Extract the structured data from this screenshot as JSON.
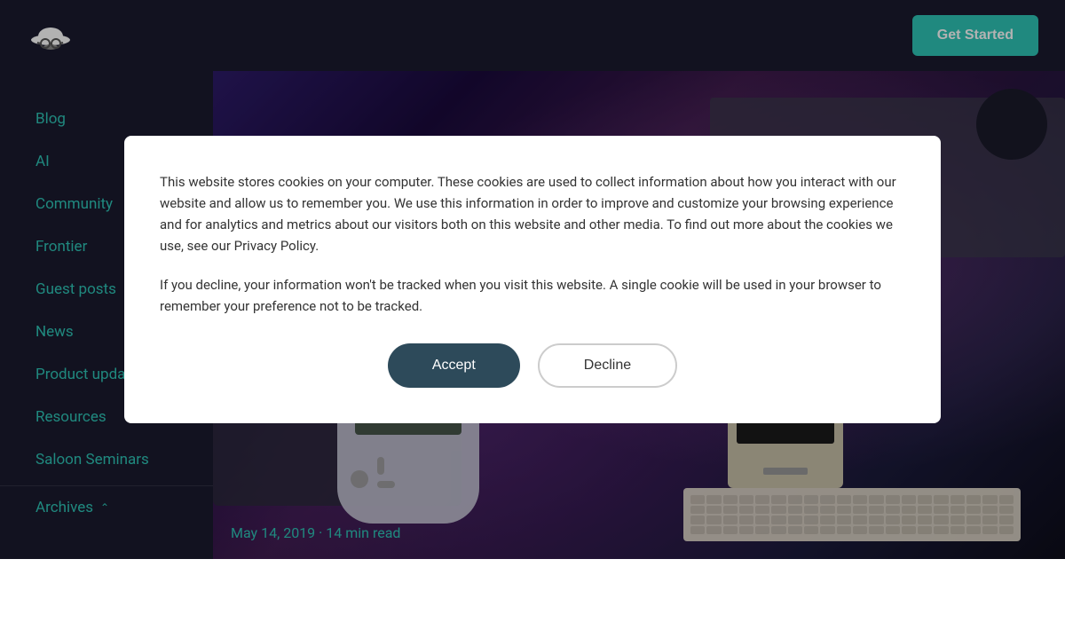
{
  "header": {
    "logo_alt": "Cowboy hat logo",
    "get_started_label": "Get Started"
  },
  "sidebar": {
    "items": [
      {
        "id": "blog",
        "label": "Blog"
      },
      {
        "id": "ai",
        "label": "AI"
      },
      {
        "id": "community",
        "label": "Community"
      },
      {
        "id": "frontier",
        "label": "Frontier"
      },
      {
        "id": "guest-posts",
        "label": "Guest posts"
      },
      {
        "id": "news",
        "label": "News"
      },
      {
        "id": "product-updates",
        "label": "Product updates"
      },
      {
        "id": "resources",
        "label": "Resources"
      },
      {
        "id": "saloon-seminars",
        "label": "Saloon Seminars"
      },
      {
        "id": "archives",
        "label": "Archives"
      }
    ]
  },
  "hero": {
    "date": "May 14, 2019",
    "read_time": "14 min read",
    "meta": "May 14, 2019 · 14 min read"
  },
  "cookie_modal": {
    "text1": "This website stores cookies on your computer. These cookies are used to collect information about how you interact with our website and allow us to remember you. We use this information in order to improve and customize your browsing experience and for analytics and metrics about our visitors both on this website and other media. To find out more about the cookies we use, see our Privacy Policy.",
    "text2": "If you decline, your information won't be tracked when you visit this website. A single cookie will be used in your browser to remember your preference not to be tracked.",
    "accept_label": "Accept",
    "decline_label": "Decline"
  }
}
